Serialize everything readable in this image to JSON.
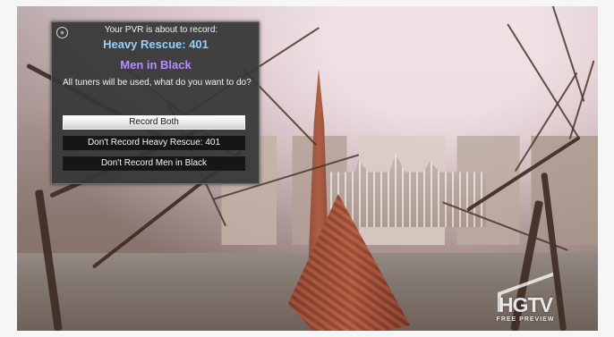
{
  "logo": {
    "title": "HGTV",
    "subtitle": "FREE PREVIEW"
  },
  "dialog": {
    "prompt": "Your PVR is about to record:",
    "programs": [
      {
        "label": "Heavy Rescue: 401",
        "color": "#8fd3ff"
      },
      {
        "label": "Men in Black",
        "color": "#b78cff"
      }
    ],
    "question": "All tuners will be used, what do you want to do?",
    "options": [
      {
        "label": "Record Both",
        "selected": true
      },
      {
        "label": "Don't Record Heavy Rescue: 401",
        "selected": false
      },
      {
        "label": "Don't Record Men in Black",
        "selected": false
      }
    ],
    "icons": {
      "close": "close-icon"
    }
  },
  "colors": {
    "dialog_background": "#363738",
    "selected_option": "#ffffff",
    "unselected_option": "#161616"
  }
}
